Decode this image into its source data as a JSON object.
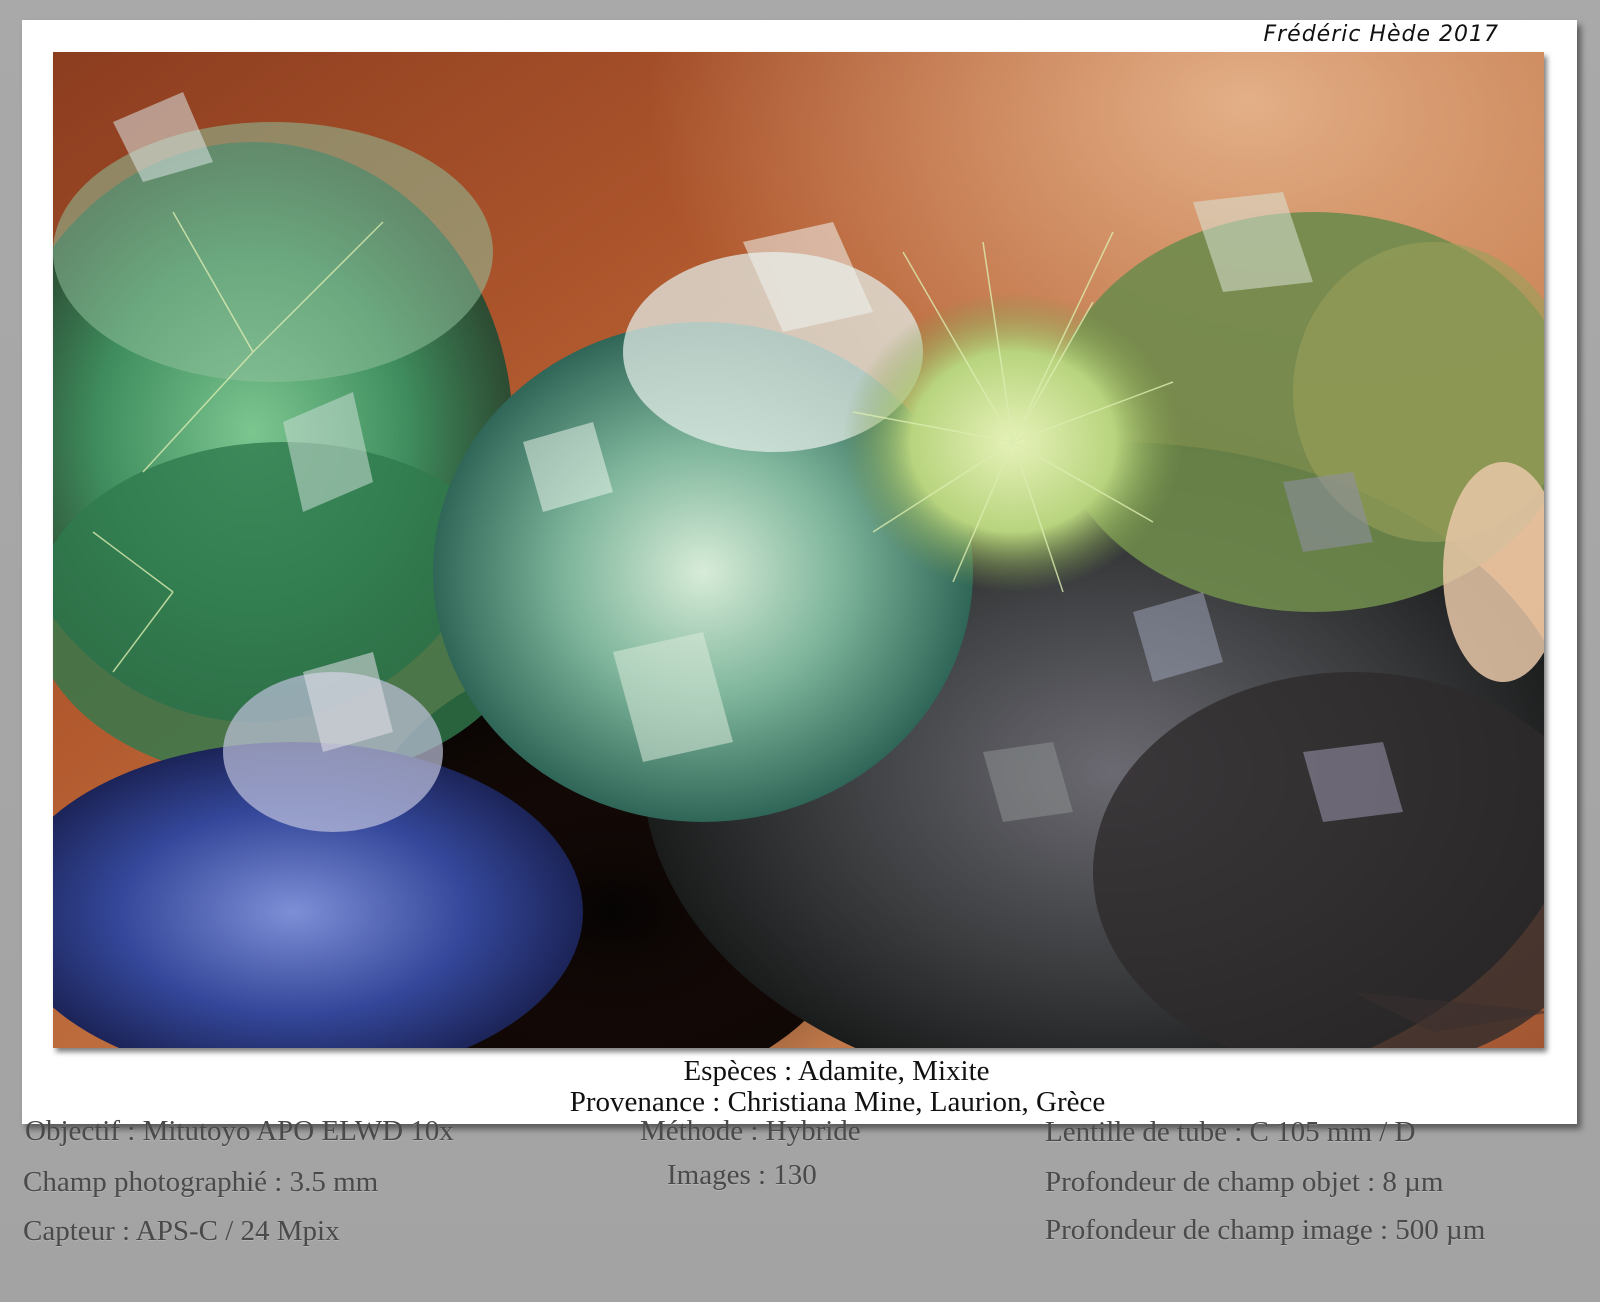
{
  "signature": "Frédéric Hède 2017",
  "caption": {
    "species": "Espèces : Adamite, Mixite",
    "origin": "Provenance : Christiana Mine, Laurion, Grèce"
  },
  "details": {
    "objective": "Objectif : Mitutoyo APO ELWD 10x",
    "field": "Champ photographié : 3.5 mm",
    "sensor": "Capteur : APS-C / 24 Mpix",
    "method": "Méthode : Hybride",
    "images": "Images : 130",
    "tube_lens": "Lentille de tube : C 105 mm / D",
    "object_dof": "Profondeur de champ objet : 8 µm",
    "image_dof": "Profondeur de champ image : 500 µm"
  },
  "colors": {
    "background": "#a7a7a7",
    "card": "#ffffff",
    "background_copper": "#a8552c",
    "crystal_green": "#5fa77a",
    "crystal_blue": "#3b4f9a",
    "mixite_green": "#cfe2a0"
  }
}
